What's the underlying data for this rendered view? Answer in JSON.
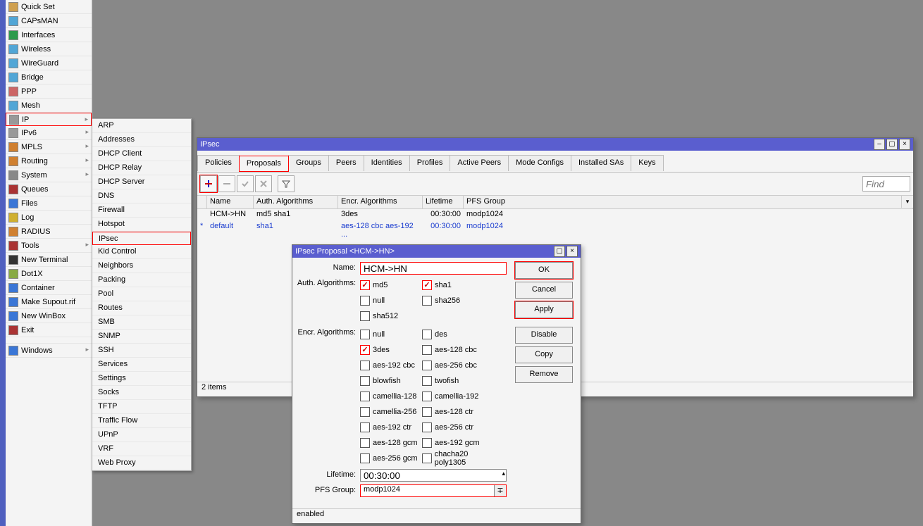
{
  "sidebar": {
    "items": [
      {
        "label": "Quick Set"
      },
      {
        "label": "CAPsMAN"
      },
      {
        "label": "Interfaces"
      },
      {
        "label": "Wireless"
      },
      {
        "label": "WireGuard"
      },
      {
        "label": "Bridge"
      },
      {
        "label": "PPP"
      },
      {
        "label": "Mesh"
      },
      {
        "label": "IP",
        "arrow": true,
        "highlight": true
      },
      {
        "label": "IPv6",
        "arrow": true
      },
      {
        "label": "MPLS",
        "arrow": true
      },
      {
        "label": "Routing",
        "arrow": true
      },
      {
        "label": "System",
        "arrow": true
      },
      {
        "label": "Queues"
      },
      {
        "label": "Files"
      },
      {
        "label": "Log"
      },
      {
        "label": "RADIUS"
      },
      {
        "label": "Tools",
        "arrow": true,
        "icon": "tools"
      },
      {
        "label": "New Terminal"
      },
      {
        "label": "Dot1X"
      },
      {
        "label": "Container"
      },
      {
        "label": "Make Supout.rif"
      },
      {
        "label": "New WinBox"
      },
      {
        "label": "Exit"
      }
    ],
    "windows_label": "Windows"
  },
  "submenu": {
    "items": [
      "ARP",
      "Addresses",
      "DHCP Client",
      "DHCP Relay",
      "DHCP Server",
      "DNS",
      "Firewall",
      "Hotspot",
      "IPsec",
      "Kid Control",
      "Neighbors",
      "Packing",
      "Pool",
      "Routes",
      "SMB",
      "SNMP",
      "SSH",
      "Services",
      "Settings",
      "Socks",
      "TFTP",
      "Traffic Flow",
      "UPnP",
      "VRF",
      "Web Proxy"
    ],
    "highlight_index": 8
  },
  "ipsec_window": {
    "title": "IPsec",
    "tabs": [
      "Policies",
      "Proposals",
      "Groups",
      "Peers",
      "Identities",
      "Profiles",
      "Active Peers",
      "Mode Configs",
      "Installed SAs",
      "Keys"
    ],
    "active_tab": 1,
    "find_placeholder": "Find",
    "columns": [
      "Name",
      "Auth. Algorithms",
      "Encr. Algorithms",
      "Lifetime",
      "PFS Group"
    ],
    "rows": [
      {
        "flag": "",
        "name": "HCM->HN",
        "auth": "md5 sha1",
        "encr": "3des",
        "lifetime": "00:30:00",
        "pfs": "modp1024",
        "link": false
      },
      {
        "flag": "*",
        "name": "default",
        "auth": "sha1",
        "encr": "aes-128 cbc aes-192 ...",
        "lifetime": "00:30:00",
        "pfs": "modp1024",
        "link": true
      }
    ],
    "status": "2 items"
  },
  "proposal_dialog": {
    "title": "IPsec Proposal <HCM->HN>",
    "name_label": "Name:",
    "name_value": "HCM->HN",
    "auth_label": "Auth. Algorithms:",
    "auth_options": [
      {
        "label": "md5",
        "checked": true,
        "hl": true
      },
      {
        "label": "sha1",
        "checked": true,
        "hl": true
      },
      {
        "label": "null",
        "checked": false
      },
      {
        "label": "sha256",
        "checked": false
      },
      {
        "label": "sha512",
        "checked": false
      }
    ],
    "encr_label": "Encr. Algorithms:",
    "encr_options": [
      {
        "label": "null",
        "checked": false
      },
      {
        "label": "des",
        "checked": false
      },
      {
        "label": "3des",
        "checked": true,
        "hl": true
      },
      {
        "label": "aes-128 cbc",
        "checked": false
      },
      {
        "label": "aes-192 cbc",
        "checked": false
      },
      {
        "label": "aes-256 cbc",
        "checked": false
      },
      {
        "label": "blowfish",
        "checked": false
      },
      {
        "label": "twofish",
        "checked": false
      },
      {
        "label": "camellia-128",
        "checked": false
      },
      {
        "label": "camellia-192",
        "checked": false
      },
      {
        "label": "camellia-256",
        "checked": false
      },
      {
        "label": "aes-128 ctr",
        "checked": false
      },
      {
        "label": "aes-192 ctr",
        "checked": false
      },
      {
        "label": "aes-256 ctr",
        "checked": false
      },
      {
        "label": "aes-128 gcm",
        "checked": false
      },
      {
        "label": "aes-192 gcm",
        "checked": false
      },
      {
        "label": "aes-256 gcm",
        "checked": false
      },
      {
        "label": "chacha20 poly1305",
        "checked": false
      }
    ],
    "lifetime_label": "Lifetime:",
    "lifetime_value": "00:30:00",
    "pfs_label": "PFS Group:",
    "pfs_value": "modp1024",
    "buttons": {
      "ok": "OK",
      "cancel": "Cancel",
      "apply": "Apply",
      "disable": "Disable",
      "copy": "Copy",
      "remove": "Remove"
    },
    "status": "enabled"
  }
}
